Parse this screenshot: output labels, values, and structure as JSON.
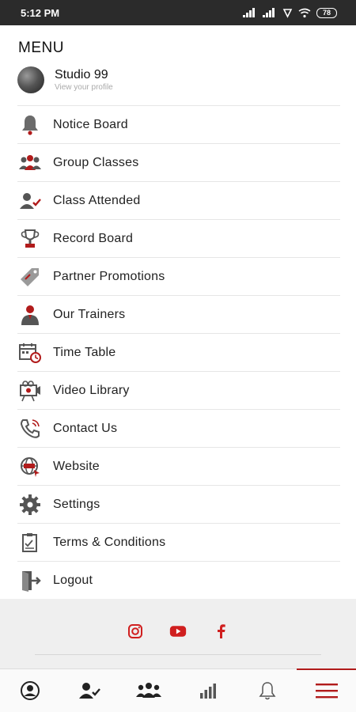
{
  "status_bar": {
    "time": "5:12 PM",
    "battery": "78"
  },
  "menu": {
    "title": "MENU",
    "profile": {
      "name": "Studio 99",
      "subtitle": "View your profile"
    },
    "items": [
      {
        "label": "Notice Board",
        "icon": "bell-icon"
      },
      {
        "label": "Group Classes",
        "icon": "group-icon"
      },
      {
        "label": "Class Attended",
        "icon": "user-check-icon"
      },
      {
        "label": "Record Board",
        "icon": "trophy-icon"
      },
      {
        "label": "Partner Promotions",
        "icon": "tag-icon"
      },
      {
        "label": "Our Trainers",
        "icon": "trainer-icon"
      },
      {
        "label": "Time Table",
        "icon": "calendar-clock-icon"
      },
      {
        "label": "Video Library",
        "icon": "video-icon"
      },
      {
        "label": "Contact Us",
        "icon": "phone-icon"
      },
      {
        "label": "Website",
        "icon": "globe-icon"
      },
      {
        "label": "Settings",
        "icon": "gear-icon"
      },
      {
        "label": "Terms & Conditions",
        "icon": "clipboard-icon"
      },
      {
        "label": "Logout",
        "icon": "logout-icon"
      }
    ]
  },
  "footer": {
    "socials": [
      "instagram-icon",
      "youtube-icon",
      "facebook-icon"
    ]
  },
  "tabbar": {
    "tabs": [
      "profile-icon",
      "class-attended-icon",
      "group-classes-icon",
      "stats-icon",
      "notification-icon",
      "menu-icon"
    ],
    "active_index": 5
  },
  "colors": {
    "accent": "#b11b1b",
    "icon_gray": "#555555",
    "status_bar": "#2b2b2b"
  }
}
